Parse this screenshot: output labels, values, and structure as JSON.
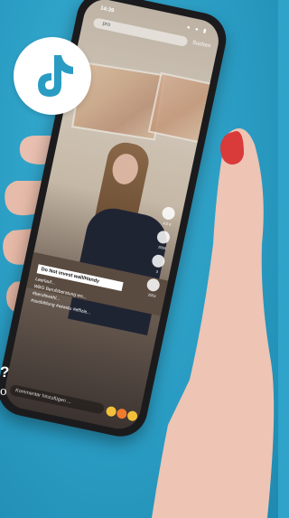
{
  "colors": {
    "background": "#2fa3c9",
    "logo_bg": "#ffffff",
    "logo_accent": "#2a9cc3"
  },
  "edge_text": {
    "line1": "?",
    "line2": "o"
  },
  "phone": {
    "status_time": "14:39",
    "status_icons": "● ● ▮",
    "search_text": "pro",
    "search_button": "Suchen",
    "caption_label": "Do Not invest wall/Handy",
    "caption_lines": [
      "Leerlauf...",
      "WBG Berufsberatung wo...",
      "#berufswahl...",
      "#ausbildung #wiwi4u #effizie..."
    ],
    "comment_placeholder": "Kommentar hinzufügen ...",
    "action_counts": [
      "4,5 K",
      "2950",
      "3",
      "2054"
    ]
  }
}
